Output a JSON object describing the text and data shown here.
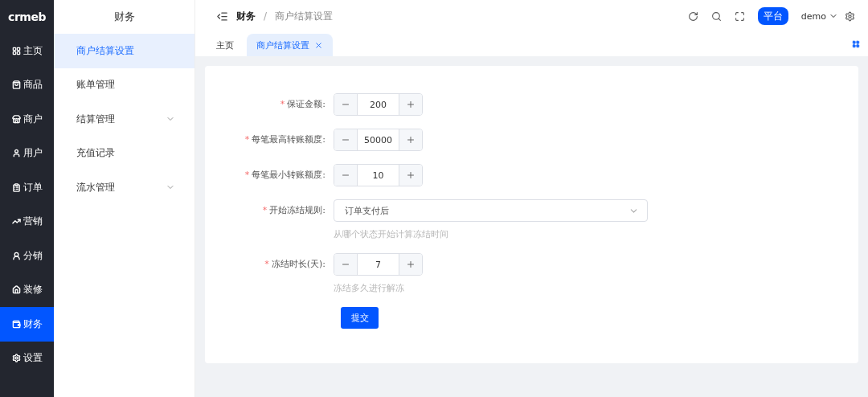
{
  "logo": "crmeb",
  "nav": [
    {
      "label": "主页",
      "selected": false
    },
    {
      "label": "商品",
      "selected": false
    },
    {
      "label": "商户",
      "selected": false
    },
    {
      "label": "用户",
      "selected": false
    },
    {
      "label": "订单",
      "selected": false
    },
    {
      "label": "营销",
      "selected": false
    },
    {
      "label": "分销",
      "selected": false
    },
    {
      "label": "装修",
      "selected": false
    },
    {
      "label": "财务",
      "selected": true
    },
    {
      "label": "设置",
      "selected": false
    }
  ],
  "submenu": {
    "title": "财务",
    "items": [
      {
        "label": "商户结算设置",
        "selected": true,
        "expandable": false
      },
      {
        "label": "账单管理",
        "selected": false,
        "expandable": false
      },
      {
        "label": "结算管理",
        "selected": false,
        "expandable": true
      },
      {
        "label": "充值记录",
        "selected": false,
        "expandable": false
      },
      {
        "label": "流水管理",
        "selected": false,
        "expandable": true
      }
    ]
  },
  "breadcrumb": {
    "items": [
      "财务",
      "商户结算设置"
    ],
    "separator": "/"
  },
  "header": {
    "platform": "平台",
    "user": "demo"
  },
  "tabs": [
    {
      "label": "主页",
      "selected": false,
      "closable": false
    },
    {
      "label": "商户结算设置",
      "selected": true,
      "closable": true
    }
  ],
  "form": {
    "fields": [
      {
        "kind": "number",
        "mark": "*",
        "label": "保证金额:",
        "value": "200"
      },
      {
        "kind": "number",
        "mark": "*",
        "label": "每笔最高转账额度:",
        "value": "50000"
      },
      {
        "kind": "number",
        "mark": "*",
        "label": "每笔最小转账额度:",
        "value": "10"
      },
      {
        "kind": "select",
        "mark": "*",
        "label": "开始冻结规则:",
        "value": "订单支付后",
        "hint": "从哪个状态开始计算冻结时间"
      },
      {
        "kind": "number",
        "mark": "*",
        "label": "冻结时长(天):",
        "value": "7",
        "hint": "冻结多久进行解冻"
      }
    ],
    "submit": "提交"
  }
}
